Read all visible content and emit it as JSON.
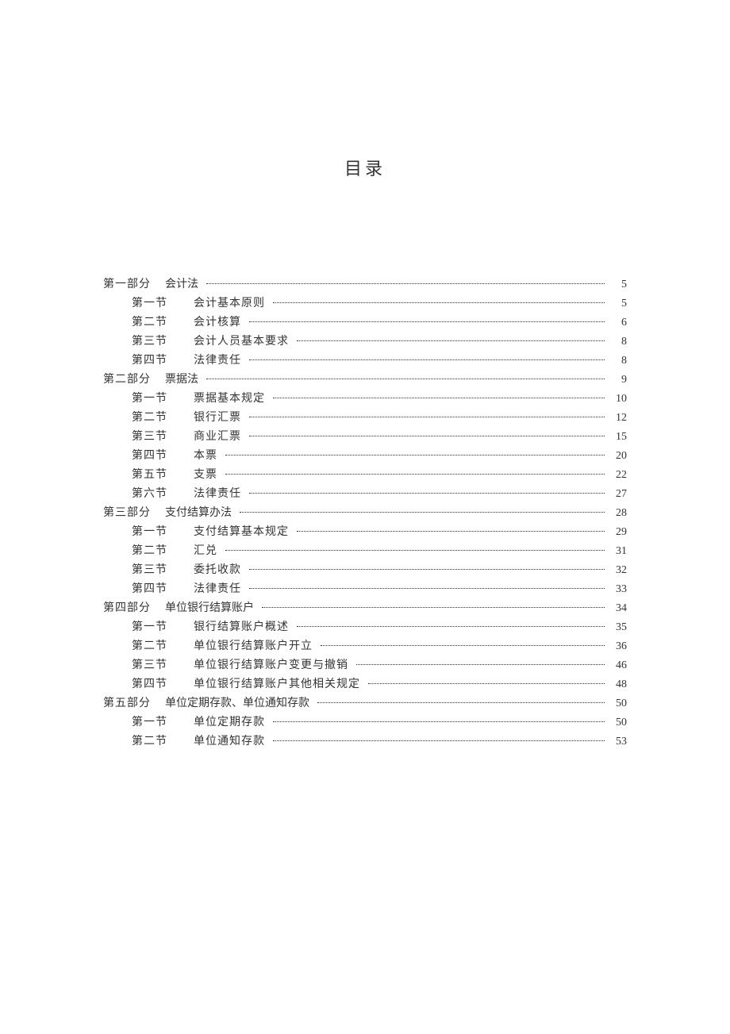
{
  "title": "目录",
  "entries": [
    {
      "level": 1,
      "label": "第一部分",
      "title": "会计法",
      "page": "5"
    },
    {
      "level": 2,
      "label": "第一节",
      "title": "会计基本原则",
      "page": "5"
    },
    {
      "level": 2,
      "label": "第二节",
      "title": "会计核算",
      "page": "6"
    },
    {
      "level": 2,
      "label": "第三节",
      "title": "会计人员基本要求",
      "page": "8"
    },
    {
      "level": 2,
      "label": "第四节",
      "title": "法律责任",
      "page": "8"
    },
    {
      "level": 1,
      "label": "第二部分",
      "title": "票据法",
      "page": "9"
    },
    {
      "level": 2,
      "label": "第一节",
      "title": "票据基本规定",
      "page": "10"
    },
    {
      "level": 2,
      "label": "第二节",
      "title": "银行汇票",
      "page": "12"
    },
    {
      "level": 2,
      "label": "第三节",
      "title": "商业汇票",
      "page": "15"
    },
    {
      "level": 2,
      "label": "第四节",
      "title": "本票",
      "page": "20"
    },
    {
      "level": 2,
      "label": "第五节",
      "title": "支票",
      "page": "22"
    },
    {
      "level": 2,
      "label": "第六节",
      "title": "法律责任",
      "page": "27"
    },
    {
      "level": 1,
      "label": "第三部分",
      "title": "支付结算办法",
      "page": "28"
    },
    {
      "level": 2,
      "label": "第一节",
      "title": "支付结算基本规定",
      "page": "29"
    },
    {
      "level": 2,
      "label": "第二节",
      "title": "汇兑",
      "page": "31"
    },
    {
      "level": 2,
      "label": "第三节",
      "title": "委托收款",
      "page": "32"
    },
    {
      "level": 2,
      "label": "第四节",
      "title": "法律责任",
      "page": "33"
    },
    {
      "level": 1,
      "label": "第四部分",
      "title": "单位银行结算账户",
      "page": "34"
    },
    {
      "level": 2,
      "label": "第一节",
      "title": "银行结算账户概述",
      "page": "35"
    },
    {
      "level": 2,
      "label": "第二节",
      "title": "单位银行结算账户开立",
      "page": "36"
    },
    {
      "level": 2,
      "label": "第三节",
      "title": "单位银行结算账户变更与撤销",
      "page": "46"
    },
    {
      "level": 2,
      "label": "第四节",
      "title": "单位银行结算账户其他相关规定",
      "page": "48"
    },
    {
      "level": 1,
      "label": "第五部分",
      "title": "单位定期存款、单位通知存款",
      "page": "50"
    },
    {
      "level": 2,
      "label": "第一节",
      "title": "单位定期存款",
      "page": "50"
    },
    {
      "level": 2,
      "label": "第二节",
      "title": "单位通知存款",
      "page": "53"
    }
  ]
}
